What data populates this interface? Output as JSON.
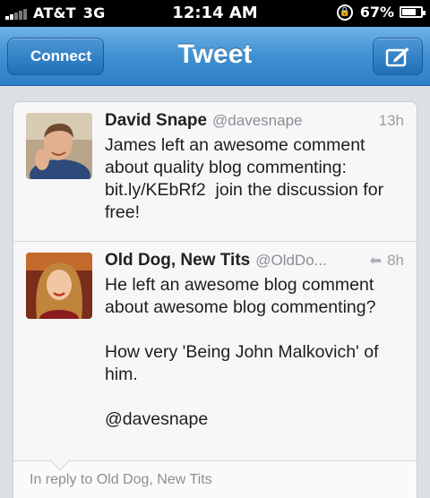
{
  "status_bar": {
    "carrier": "AT&T",
    "network": "3G",
    "time": "12:14 AM",
    "battery": "67%",
    "icons": [
      "signal-icon",
      "rotation-lock-icon",
      "battery-icon"
    ]
  },
  "nav": {
    "back_label": "Connect",
    "title": "Tweet",
    "compose_icon": "compose-icon"
  },
  "tweets": [
    {
      "name": "David Snape",
      "handle": "@davesnape",
      "time": "13h",
      "text": "James left an awesome comment about quality blog commenting: bit.ly/KEbRf2  join the discussion for free!"
    },
    {
      "name": "Old Dog, New Tits",
      "handle": "@OldDo...",
      "time": "8h",
      "text": "He left an awesome blog comment about awesome blog commenting?\n\nHow very 'Being John Malkovich' of him.\n\n@davesnape"
    }
  ],
  "reply": {
    "label": "In reply to Old Dog, New Tits"
  },
  "colors": {
    "nav_blue": "#3f8fd2",
    "text": "#1e1e1e",
    "muted": "#8a8f96"
  }
}
